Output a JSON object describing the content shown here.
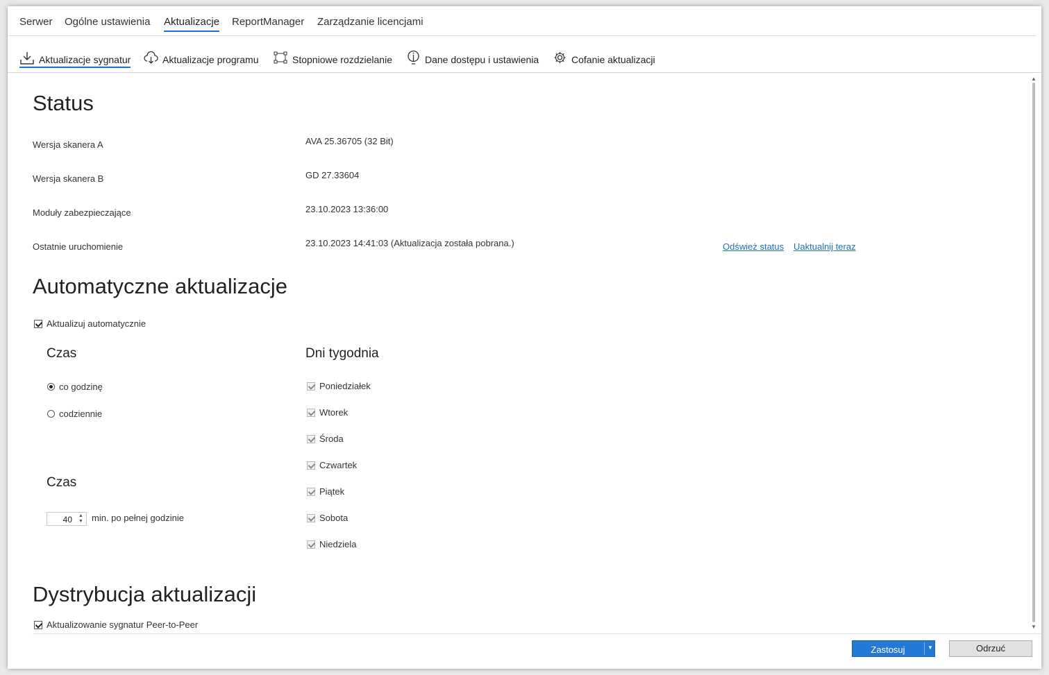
{
  "tabs": [
    {
      "label": "Serwer"
    },
    {
      "label": "Ogólne ustawienia"
    },
    {
      "label": "Aktualizacje",
      "active": true
    },
    {
      "label": "ReportManager"
    },
    {
      "label": "Zarządzanie licencjami"
    }
  ],
  "subtabs": [
    {
      "label": "Aktualizacje sygnatur",
      "icon": "download-icon",
      "active": true
    },
    {
      "label": "Aktualizacje programu",
      "icon": "cloud-download-icon"
    },
    {
      "label": "Stopniowe rozdzielanie",
      "icon": "distribution-icon"
    },
    {
      "label": "Dane dostępu i ustawienia",
      "icon": "info-icon"
    },
    {
      "label": "Cofanie aktualizacji",
      "icon": "gear-icon"
    }
  ],
  "status": {
    "title": "Status",
    "rows": [
      {
        "label": "Wersja skanera A",
        "value": "AVA 25.36705 (32 Bit)"
      },
      {
        "label": "Wersja skanera B",
        "value": "GD 27.33604"
      },
      {
        "label": "Moduły zabezpieczające",
        "value": "23.10.2023 13:36:00"
      },
      {
        "label": "Ostatnie uruchomienie",
        "value": "23.10.2023 14:41:03 (Aktualizacja została pobrana.)"
      }
    ],
    "refresh_link": "Odśwież status",
    "update_now_link": "Uaktualnij teraz"
  },
  "auto": {
    "title": "Automatyczne aktualizacje",
    "auto_checkbox": {
      "label": "Aktualizuj automatycznie",
      "checked": true
    },
    "time_title": "Czas",
    "hourly": {
      "label": "co godzinę",
      "selected": true
    },
    "daily": {
      "label": "codziennie",
      "selected": false
    },
    "time2_title": "Czas",
    "minutes": {
      "value": "40",
      "suffix": "min. po pełnej godzinie"
    },
    "days_title": "Dni tygodnia",
    "days": [
      {
        "label": "Poniedziałek",
        "checked": true
      },
      {
        "label": "Wtorek",
        "checked": true
      },
      {
        "label": "Środa",
        "checked": true
      },
      {
        "label": "Czwartek",
        "checked": true
      },
      {
        "label": "Piątek",
        "checked": true
      },
      {
        "label": "Sobota",
        "checked": true
      },
      {
        "label": "Niedziela",
        "checked": true
      }
    ]
  },
  "distribution": {
    "title": "Dystrybucja aktualizacji",
    "p2p_checkbox": {
      "label": "Aktualizowanie sygnatur Peer-to-Peer",
      "checked": true
    }
  },
  "footer": {
    "apply_label": "Zastosuj",
    "discard_label": "Odrzuć"
  },
  "colors": {
    "accent": "#1f6fd1",
    "link": "#1a6fc0",
    "apply_button": "#2579d6"
  }
}
